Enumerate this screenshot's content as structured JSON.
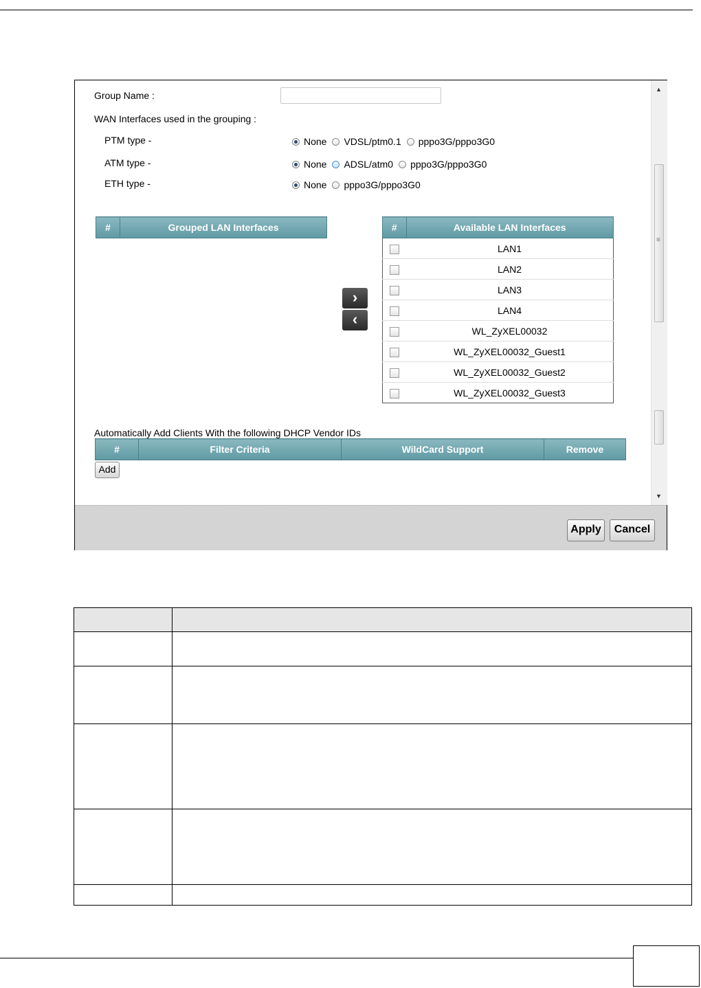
{
  "form": {
    "group_name_label": "Group Name :",
    "group_name_value": "",
    "wan_heading": "WAN Interfaces used in the grouping :",
    "ptm": {
      "label": "PTM type -",
      "options": [
        "None",
        "VDSL/ptm0.1",
        "pppo3G/pppo3G0"
      ],
      "selected": "None"
    },
    "atm": {
      "label": "ATM type -",
      "options": [
        "None",
        "ADSL/atm0",
        "pppo3G/pppo3G0"
      ],
      "selected": "None"
    },
    "eth": {
      "label": "ETH type -",
      "options": [
        "None",
        "pppo3G/pppo3G0"
      ],
      "selected": "None"
    }
  },
  "grouped_table": {
    "headers": [
      "#",
      "Grouped LAN Interfaces"
    ],
    "rows": []
  },
  "available_table": {
    "headers": [
      "#",
      "Available LAN Interfaces"
    ],
    "rows": [
      "LAN1",
      "LAN2",
      "LAN3",
      "LAN4",
      "WL_ZyXEL00032",
      "WL_ZyXEL00032_Guest1",
      "WL_ZyXEL00032_Guest2",
      "WL_ZyXEL00032_Guest3"
    ]
  },
  "move_buttons": {
    "add_icon": "chevron-right-icon",
    "remove_icon": "chevron-left-icon"
  },
  "vendor": {
    "heading": "Automatically Add Clients With the following DHCP Vendor IDs",
    "headers": [
      "#",
      "Filter Criteria",
      "WildCard Support",
      "Remove"
    ],
    "add_label": "Add"
  },
  "footer": {
    "apply_label": "Apply",
    "cancel_label": "Cancel"
  },
  "colors": {
    "table_header": "#6fa6ae",
    "footer_bar": "#d4d4d4",
    "move_button": "#3a3a3a"
  }
}
